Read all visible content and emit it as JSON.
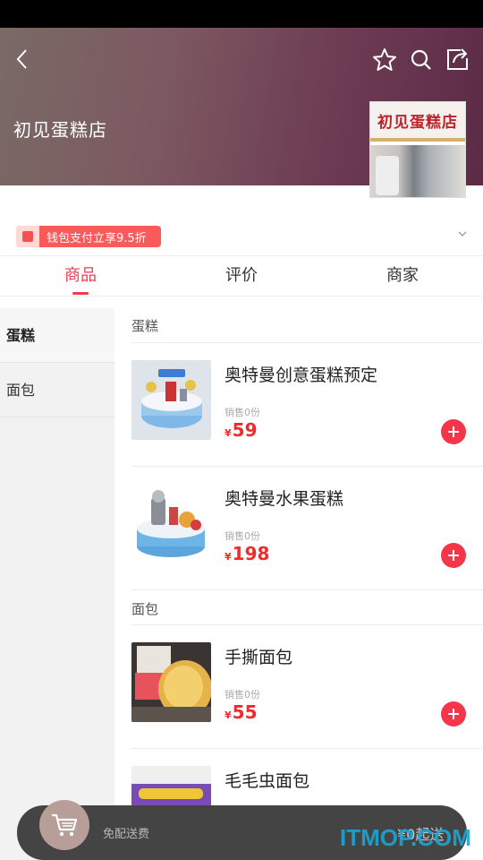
{
  "shop": {
    "name": "初见蛋糕店",
    "photo_sign": "初见蛋糕店"
  },
  "promo": {
    "text": "钱包支付立享9.5折"
  },
  "tabs": [
    {
      "label": "商品"
    },
    {
      "label": "评价"
    },
    {
      "label": "商家"
    }
  ],
  "sidebar": {
    "items": [
      {
        "label": "蛋糕",
        "active": true
      },
      {
        "label": "面包",
        "active": false
      }
    ]
  },
  "sections": [
    {
      "title": "蛋糕",
      "products": [
        {
          "name": "奥特曼创意蛋糕预定",
          "sales": "销售0份",
          "currency": "¥",
          "price": "59"
        },
        {
          "name": "奥特曼水果蛋糕",
          "sales": "销售0份",
          "currency": "¥",
          "price": "198"
        }
      ]
    },
    {
      "title": "面包",
      "products": [
        {
          "name": "手撕面包",
          "sales": "销售0份",
          "currency": "¥",
          "price": "55"
        },
        {
          "name": "毛毛虫面包",
          "sales": "",
          "currency": "",
          "price": ""
        }
      ]
    }
  ],
  "cart": {
    "free_shipping": "免配送费",
    "min_order": "¥0起送"
  },
  "watermark": "ITMOP.COM",
  "colors": {
    "accent": "#f23a4f",
    "price": "#f12b2b",
    "cart_bar": "#444444"
  }
}
